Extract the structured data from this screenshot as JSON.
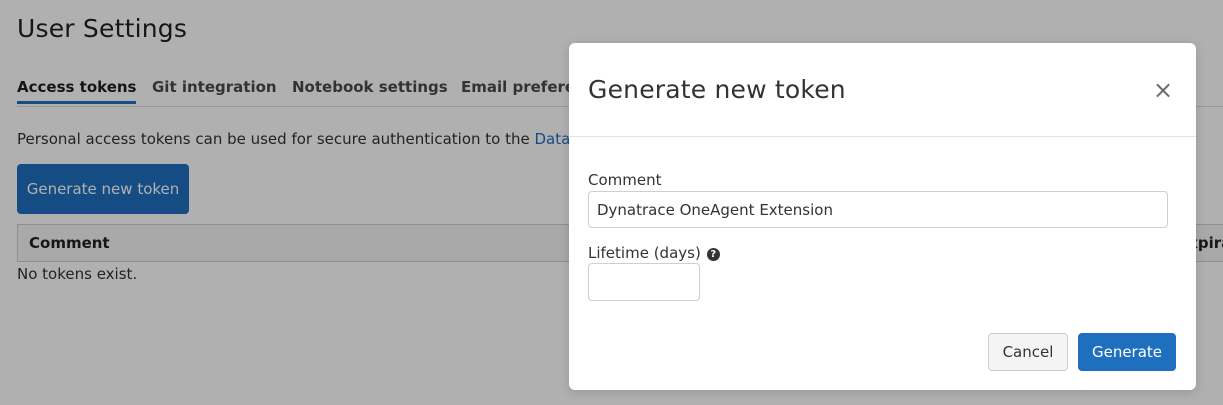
{
  "page": {
    "title": "User Settings",
    "tabs": [
      {
        "label": "Access tokens",
        "active": true
      },
      {
        "label": "Git integration",
        "active": false
      },
      {
        "label": "Notebook settings",
        "active": false
      },
      {
        "label": "Email preferences",
        "active": false
      }
    ],
    "intro_text": "Personal access tokens can be used for secure authentication to the ",
    "intro_link": "Databricks",
    "generate_button_label": "Generate new token",
    "table": {
      "columns": [
        "Comment",
        "Expiration"
      ]
    },
    "empty_message": "No tokens exist."
  },
  "modal": {
    "title": "Generate new token",
    "close_glyph": "×",
    "comment_label": "Comment",
    "comment_value": "Dynatrace OneAgent Extension",
    "lifetime_label": "Lifetime (days)",
    "help_glyph": "?",
    "lifetime_value": "",
    "cancel_label": "Cancel",
    "generate_label": "Generate"
  },
  "colors": {
    "accent": "#1f6fbf",
    "overlay": "rgba(0,0,0,0.31)"
  },
  "icons": {
    "close": "close-icon",
    "help": "question-circle-icon"
  }
}
